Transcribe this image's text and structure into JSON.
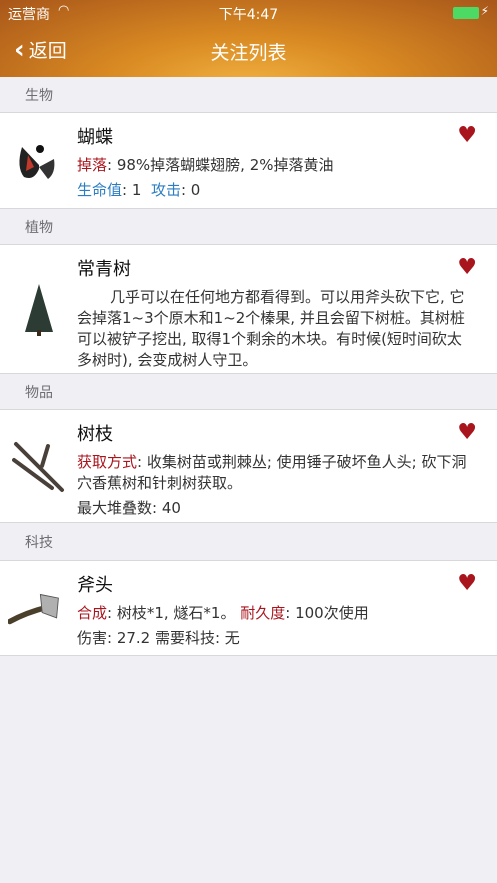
{
  "status": {
    "carrier": "运营商",
    "time": "下午4:47"
  },
  "nav": {
    "back": "返回",
    "title": "关注列表"
  },
  "colors": {
    "accent_red": "#a9151d",
    "accent_blue": "#2b7ec3"
  },
  "sections": [
    {
      "header": "生物",
      "item": {
        "name": "蝴蝶",
        "l1_label": "掉落",
        "l1_text": ": 98%掉落蝴蝶翅膀, 2%掉落黄油",
        "hp_label": "生命值",
        "hp_value": ": 1",
        "atk_label": "攻击",
        "atk_value": ": 0"
      }
    },
    {
      "header": "植物",
      "item": {
        "name": "常青树",
        "desc": "几乎可以在任何地方都看得到。可以用斧头砍下它, 它会掉落1~3个原木和1~2个榛果, 并且会留下树桩。其树桩可以被铲子挖出, 取得1个剩余的木块。有时候(短时间砍太多树时), 会变成树人守卫。"
      }
    },
    {
      "header": "物品",
      "item": {
        "name": "树枝",
        "l1_label": "获取方式",
        "l1_text": ": 收集树苗或荆棘丛; 使用锤子破坏鱼人头; 砍下洞穴香蕉树和针刺树获取。",
        "l2": "最大堆叠数: 40"
      }
    },
    {
      "header": "科技",
      "item": {
        "name": "斧头",
        "l1_label": "合成",
        "l1_text": ": 树枝*1, 燧石*1。 ",
        "l1b_label": "耐久度",
        "l1b_text": ": 100次使用",
        "l2": "伤害: 27.2 需要科技: 无"
      }
    }
  ]
}
